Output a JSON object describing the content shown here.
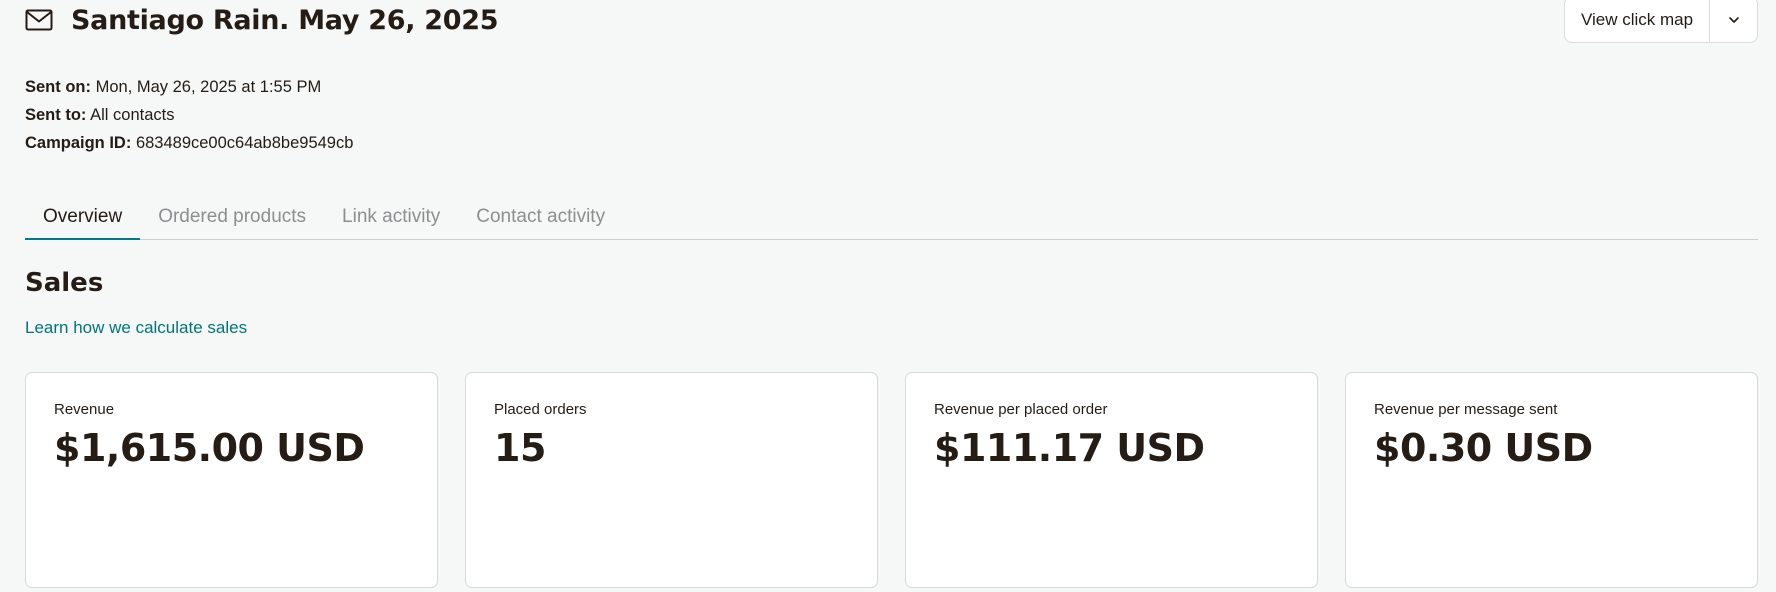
{
  "header": {
    "title": "Santiago Rain. May 26, 2025",
    "icon": "envelope-icon"
  },
  "actions": {
    "view_click_map_label": "View click map",
    "toggle_icon": "chevron-down-icon"
  },
  "meta": {
    "sent_on_label": "Sent on:",
    "sent_on_value": "Mon, May 26, 2025 at 1:55 PM",
    "sent_to_label": "Sent to:",
    "sent_to_value": "All contacts",
    "campaign_id_label": "Campaign ID:",
    "campaign_id_value": "683489ce00c64ab8be9549cb"
  },
  "tabs": [
    {
      "label": "Overview",
      "active": true
    },
    {
      "label": "Ordered products",
      "active": false
    },
    {
      "label": "Link activity",
      "active": false
    },
    {
      "label": "Contact activity",
      "active": false
    }
  ],
  "sales": {
    "title": "Sales",
    "link_label": "Learn how we calculate sales",
    "cards": [
      {
        "label": "Revenue",
        "value": "$1,615.00 USD"
      },
      {
        "label": "Placed orders",
        "value": "15"
      },
      {
        "label": "Revenue per placed order",
        "value": "$111.17 USD"
      },
      {
        "label": "Revenue per message sent",
        "value": "$0.30 USD"
      }
    ]
  },
  "colors": {
    "accent": "#007c89",
    "link": "#00767a",
    "text": "#241c15",
    "muted_tab": "#8a9090",
    "background": "#f6f7f7"
  }
}
